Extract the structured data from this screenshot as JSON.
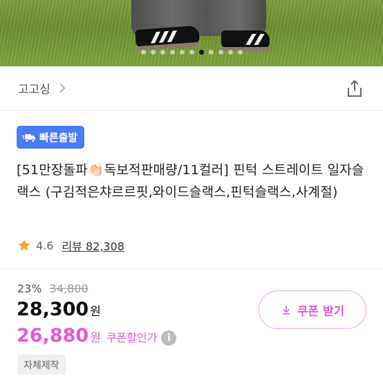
{
  "gallery": {
    "dot_count": 11,
    "active_dot": 6
  },
  "shop": {
    "name": "고고싱"
  },
  "badge": {
    "label": "빠른출발",
    "color": "#4a7cf6"
  },
  "product": {
    "title_part1": "[51만장돌파",
    "title_emoji": "👏🏻",
    "title_part2": "독보적판매량/11컬러] 핀턱 스트레이트 일자슬랙스 (구김적은챠르르핏,와이드슬랙스,핀턱슬랙스,사계절)"
  },
  "rating": {
    "score": "4.6",
    "reviews_label": "리뷰 82,308"
  },
  "price": {
    "discount": "23%",
    "original": "34,800",
    "sale": "28,300",
    "won": "원",
    "coupon_price": "26,880",
    "coupon_won": "원",
    "coupon_label": "쿠폰할인가",
    "info_glyph": "i",
    "accent_color": "#e259d6"
  },
  "coupon_button": {
    "label": "쿠폰 받기"
  },
  "tags": {
    "self_made": "자체제작"
  }
}
